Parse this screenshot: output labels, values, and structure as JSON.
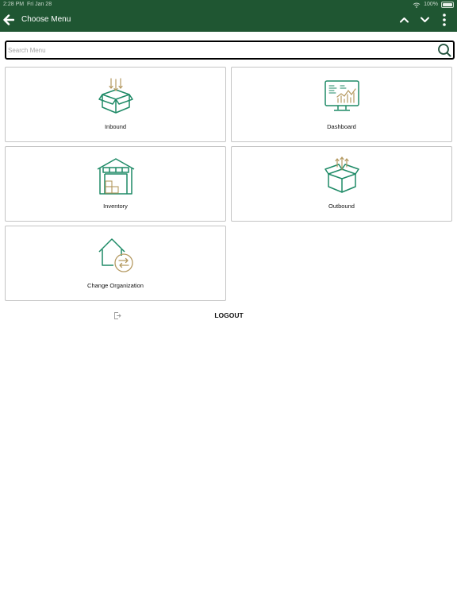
{
  "status_bar": {
    "time": "2:28 PM",
    "date": "Fri Jan 28",
    "battery": "100%"
  },
  "header": {
    "title": "Choose Menu",
    "icons": [
      "back-arrow-icon",
      "chevron-up-icon",
      "chevron-down-icon",
      "more-vertical-icon"
    ]
  },
  "search": {
    "placeholder": "Search Menu",
    "value": ""
  },
  "menu": {
    "items": [
      {
        "label": "Inbound",
        "icon": "inbound-box-icon"
      },
      {
        "label": "Dashboard",
        "icon": "dashboard-monitor-icon"
      },
      {
        "label": "Inventory",
        "icon": "warehouse-icon"
      },
      {
        "label": "Outbound",
        "icon": "outbound-box-icon"
      },
      {
        "label": "Change Organization",
        "icon": "change-organization-icon"
      }
    ]
  },
  "logout": {
    "label": "LOGOUT"
  },
  "colors": {
    "header_bg": "#1f5632",
    "icon_green": "#1e8a66",
    "icon_gold": "#b59a62",
    "tile_border": "#c4c4c4"
  }
}
